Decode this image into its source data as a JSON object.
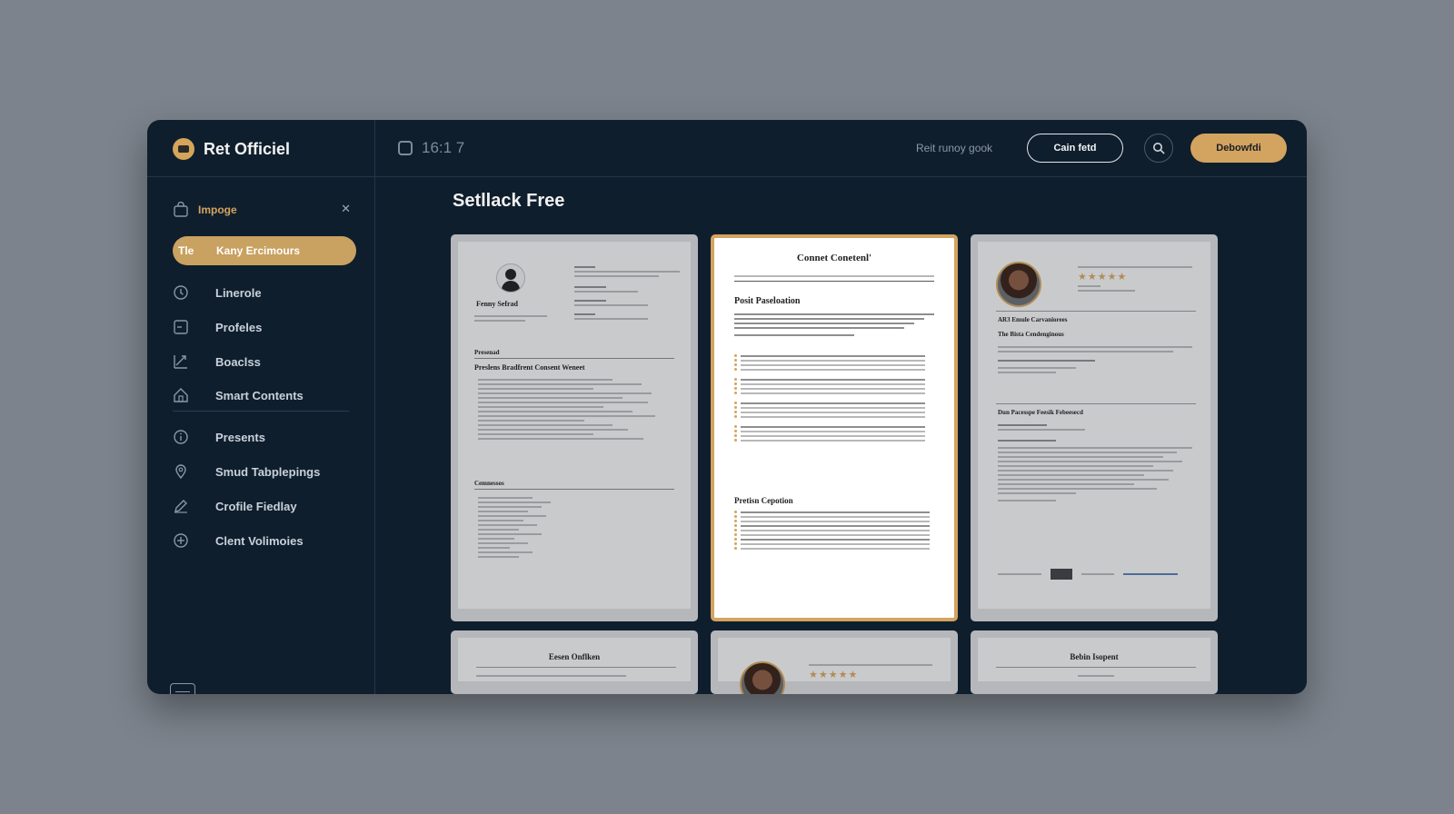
{
  "app": {
    "brand": "Ret Officiel",
    "breadcrumb": "16:1 7",
    "top_link": "Reit runoy gook",
    "outline_button": "Cain fetd",
    "primary_button": "Debowfdi"
  },
  "sidebar": {
    "header_label": "Impoge",
    "active_item": {
      "abbr": "Tle",
      "label": "Kany Ercimours"
    },
    "items": [
      {
        "label": "Linerole",
        "icon": "clock-icon"
      },
      {
        "label": "Profeles",
        "icon": "minus-box-icon"
      },
      {
        "label": "Boaclss",
        "icon": "chart-icon"
      },
      {
        "label": "Smart Contents",
        "icon": "home-icon"
      },
      {
        "label": "Presents",
        "icon": "info-icon"
      },
      {
        "label": "Smud Tabplepings",
        "icon": "pin-icon"
      },
      {
        "label": "Crofile Fiedlay",
        "icon": "pencil-icon"
      },
      {
        "label": "Clent Volimoies",
        "icon": "plus-circle-icon"
      }
    ]
  },
  "main": {
    "title": "Setllack Free",
    "cards": [
      {
        "name": "Fenny Sefrad",
        "section_a": "Presenad",
        "section_b": "Preslens Bradfrent Consent Weneet",
        "section_c": "Cemnessos"
      },
      {
        "title": "Connet Conetenl'",
        "section_a": "Posit Paseloation",
        "section_b": "Pretisn Cepotion"
      },
      {
        "section_a": "AR3 Emule Carvaniorees",
        "section_b": "The Bista Cendenginous",
        "section_c": "Dun Pacesspe Feesik Febeesecd",
        "rating": "★★★★★"
      },
      {
        "title": "Eesen Onflken"
      },
      {
        "rating": "★★★★★"
      },
      {
        "title": "Bebin Isopent"
      }
    ]
  }
}
